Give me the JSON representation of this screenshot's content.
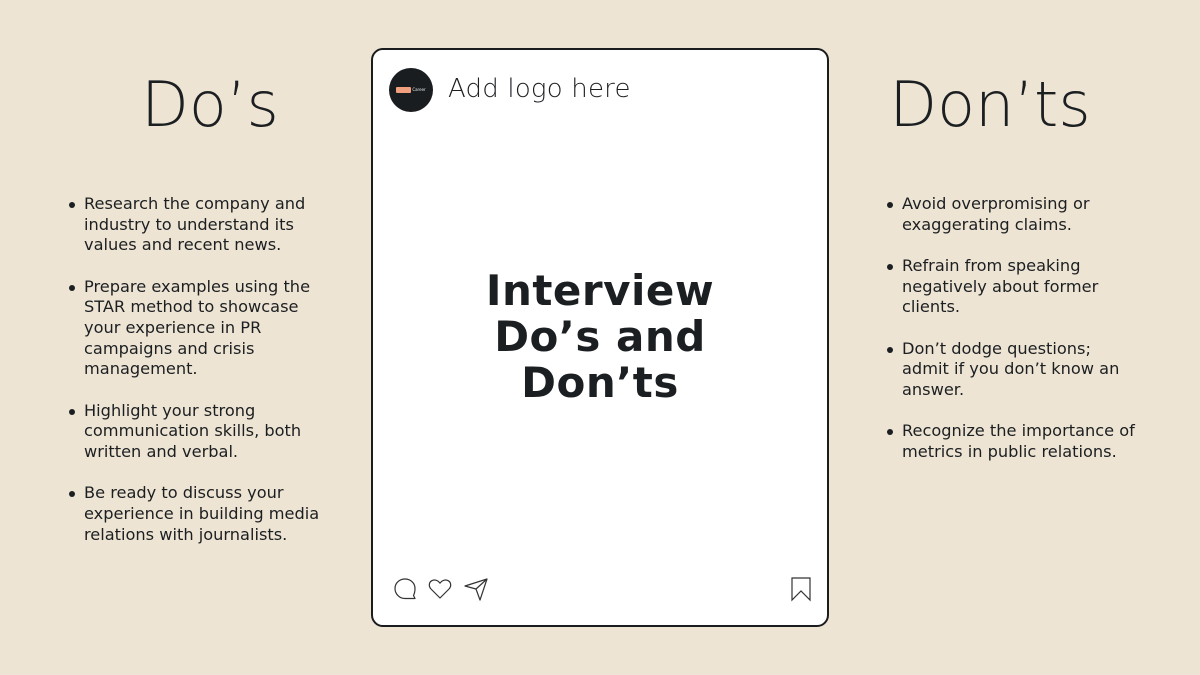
{
  "dos": {
    "heading": "Do’s",
    "items": [
      "Research the company and industry to understand its values and recent news.",
      "Prepare examples using the STAR method to showcase your experience in PR campaigns and crisis management.",
      "Highlight your strong communication skills, both written and verbal.",
      "Be ready to discuss your experience in building media relations with journalists."
    ]
  },
  "donts": {
    "heading": "Don’ts",
    "items": [
      "Avoid overpromising or exaggerating claims.",
      "Refrain from speaking negatively about former clients.",
      "Don’t dodge questions; admit if you don’t know an answer.",
      "Recognize the importance of metrics in public relations."
    ]
  },
  "post": {
    "logo_label": "Add logo here",
    "logo_badge_text": "Career",
    "title_lines": [
      "Interview",
      "Do’s and",
      "Don’ts"
    ],
    "actions": {
      "left": [
        "comment-icon",
        "heart-icon",
        "send-icon"
      ],
      "right": [
        "bookmark-icon"
      ]
    }
  },
  "colors": {
    "background": "#ede4d3",
    "text": "#1c1f22",
    "card": "#ffffff",
    "logo_circle": "#1a1d20",
    "logo_badge": "#f0a07f"
  }
}
